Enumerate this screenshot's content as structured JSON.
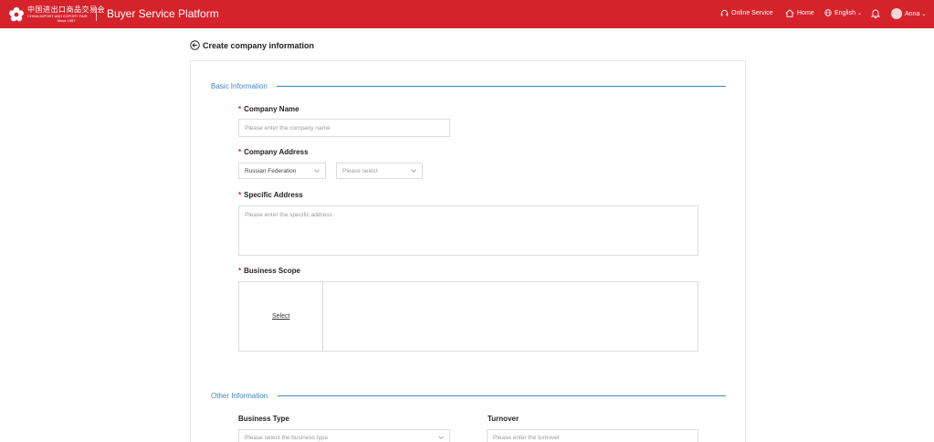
{
  "header": {
    "logo_cn": "中国进出口商品交易会",
    "logo_en": "CHINA IMPORT AND EXPORT FAIR",
    "logo_since": "Since 1957",
    "platform_title": "Buyer Service Platform",
    "nav": {
      "online_service": "Online Service",
      "home": "Home",
      "language": "English",
      "user": "Anna"
    },
    "icons": {
      "headset": "headset-icon",
      "home": "home-icon",
      "globe": "globe-icon",
      "bell": "bell-icon",
      "avatar": "avatar"
    }
  },
  "page": {
    "title": "Create company information",
    "back_icon": "back-arrow-icon"
  },
  "form": {
    "basic_section": "Basic Information",
    "company_name": {
      "required": "*",
      "label": "Company Name",
      "placeholder": "Please enter the company name"
    },
    "company_address": {
      "required": "*",
      "label": "Company Address",
      "country_value": "Russian Federation",
      "region_placeholder": "Please select"
    },
    "specific_address": {
      "required": "*",
      "label": "Specific Address",
      "placeholder": "Please enter the specific address"
    },
    "business_scope": {
      "required": "*",
      "label": "Business Scope",
      "select_link": "Select"
    },
    "other_section": "Other Information",
    "business_type": {
      "label": "Business Type",
      "placeholder": "Please select the business type"
    },
    "turnover": {
      "label": "Turnover",
      "placeholder": "Please enter the turnover"
    }
  },
  "colors": {
    "brand_red": "#d5232c",
    "section_blue": "#3e86c4",
    "border_gray": "#dcdcdc"
  }
}
